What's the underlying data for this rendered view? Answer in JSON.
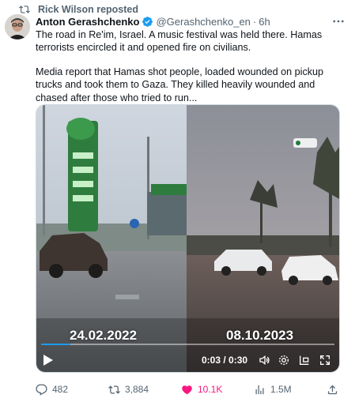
{
  "repost": {
    "label": "Rick Wilson reposted",
    "icon": "repost-icon"
  },
  "author": {
    "name": "Anton Gerashchenko",
    "handle": "@Gerashchenko_en",
    "dot": "·",
    "time": "6h",
    "verified_icon": "verified-badge-icon",
    "more_icon": "more-options-icon"
  },
  "post": {
    "paragraph1": "The road in Re'im, Israel. A music festival was held there. Hamas terrorists encircled it and opened fire on civilians.",
    "paragraph2": "Media report that Hamas shot people, loaded wounded on pickup trucks and took them to Gaza. They killed heavily wounded and chased after those who tried to run..."
  },
  "video": {
    "left_date": "24.02.2022",
    "right_date": "08.10.2023",
    "time": "0:03 / 0:30",
    "progress": 0.1,
    "icons": [
      "play-icon",
      "volume-icon",
      "settings-icon",
      "pip-icon",
      "fullscreen-icon"
    ]
  },
  "actions": {
    "replies": "482",
    "reposts": "3,884",
    "likes": "10.1K",
    "views": "1.5M",
    "icons": [
      "reply-icon",
      "repost-icon",
      "like-icon",
      "views-icon",
      "share-icon"
    ],
    "like_color": "#f91880"
  },
  "colors": {
    "text": "#0f1419",
    "secondary": "#536471",
    "accent": "#1d9bf0"
  }
}
